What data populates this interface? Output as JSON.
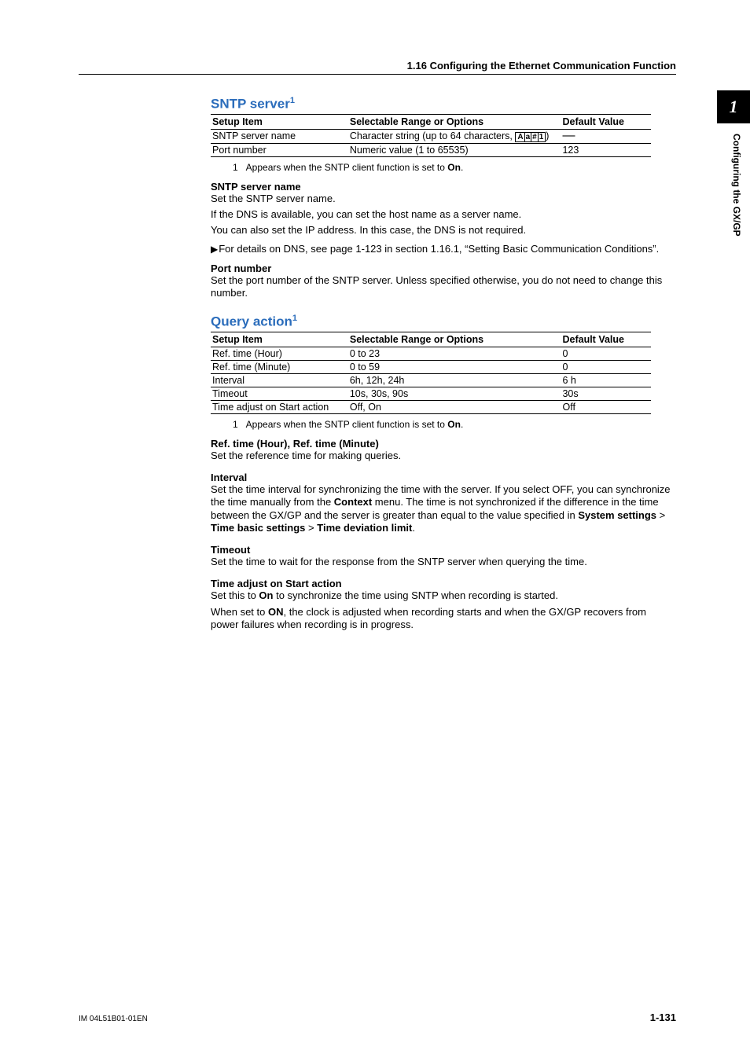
{
  "header": {
    "section_title": "1.16  Configuring the Ethernet Communication Function"
  },
  "tab": {
    "number": "1",
    "side_text": "Configuring the GX/GP"
  },
  "sntp_server": {
    "title": "SNTP server",
    "sup": "1",
    "columns": {
      "setup": "Setup Item",
      "range": "Selectable Range or Options",
      "default": "Default Value"
    },
    "rows": [
      {
        "setup": "SNTP server name",
        "range_pre": "Character string (up to 64 characters, ",
        "range_box": [
          "A",
          "a",
          "#",
          "1"
        ],
        "range_post": ")",
        "default": "―"
      },
      {
        "setup": "Port number",
        "range": "Numeric value (1 to 65535)",
        "default": "123"
      }
    ],
    "footnote": {
      "num": "1",
      "text": "Appears when the SNTP client function is set to ",
      "bold": "On",
      "tail": "."
    },
    "name_sub": {
      "title": "SNTP server name",
      "l1": "Set the SNTP server name.",
      "l2": "If the DNS is available, you can set the host name as a server name.",
      "l3": "You can also set the IP address. In this case, the DNS is not required."
    },
    "xref": {
      "text": "For details on DNS, see page 1-123 in section 1.16.1, “Setting Basic Communication Conditions”."
    },
    "port_sub": {
      "title": "Port number",
      "body": "Set the port number of the SNTP server. Unless specified otherwise, you do not need to change this number."
    }
  },
  "query_action": {
    "title": "Query action",
    "sup": "1",
    "columns": {
      "setup": "Setup Item",
      "range": "Selectable Range or Options",
      "default": "Default Value"
    },
    "rows": [
      {
        "setup": "Ref. time (Hour)",
        "range": "0 to 23",
        "default": "0"
      },
      {
        "setup": "Ref. time (Minute)",
        "range": "0 to 59",
        "default": "0"
      },
      {
        "setup": "Interval",
        "range": "6h, 12h, 24h",
        "default": "6 h"
      },
      {
        "setup": "Timeout",
        "range": "10s, 30s, 90s",
        "default": "30s"
      },
      {
        "setup": "Time adjust on Start action",
        "range": "Off, On",
        "default": "Off"
      }
    ],
    "footnote": {
      "num": "1",
      "text": "Appears when the SNTP client function is set to ",
      "bold": "On",
      "tail": "."
    },
    "reftime_sub": {
      "title": "Ref. time (Hour), Ref. time (Minute)",
      "body": "Set the reference time for making queries."
    },
    "interval_sub": {
      "title": "Interval",
      "pre": "Set the time interval for synchronizing the time with the server. If you select OFF, you can synchronize the time manually from the ",
      "b1": "Context",
      "mid1": " menu. The time is not synchronized if the difference in the time between the GX/GP and the server is greater than equal to the value specified in ",
      "b2": "System settings",
      "gt1": " > ",
      "b3": "Time basic settings",
      "gt2": " > ",
      "b4": "Time deviation limit",
      "tail": "."
    },
    "timeout_sub": {
      "title": "Timeout",
      "body": "Set the time to wait for the response from the SNTP server when querying the time."
    },
    "adjust_sub": {
      "title": "Time adjust on Start action",
      "l1_pre": "Set this to ",
      "l1_b": "On",
      "l1_post": " to synchronize the time using SNTP when recording is started.",
      "l2_pre": "When set to ",
      "l2_b": "ON",
      "l2_post": ", the clock is adjusted when recording starts and when the GX/GP recovers from power failures when recording is in progress."
    }
  },
  "footer": {
    "left": "IM 04L51B01-01EN",
    "right": "1-131"
  }
}
